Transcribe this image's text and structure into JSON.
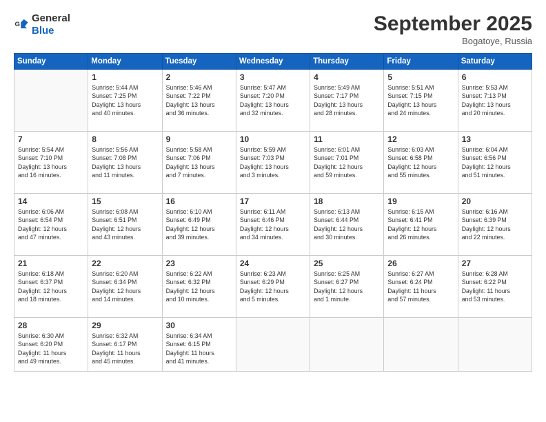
{
  "header": {
    "logo_general": "General",
    "logo_blue": "Blue",
    "month_title": "September 2025",
    "location": "Bogatoye, Russia"
  },
  "weekdays": [
    "Sunday",
    "Monday",
    "Tuesday",
    "Wednesday",
    "Thursday",
    "Friday",
    "Saturday"
  ],
  "weeks": [
    [
      {
        "day": "",
        "info": ""
      },
      {
        "day": "1",
        "info": "Sunrise: 5:44 AM\nSunset: 7:25 PM\nDaylight: 13 hours\nand 40 minutes."
      },
      {
        "day": "2",
        "info": "Sunrise: 5:46 AM\nSunset: 7:22 PM\nDaylight: 13 hours\nand 36 minutes."
      },
      {
        "day": "3",
        "info": "Sunrise: 5:47 AM\nSunset: 7:20 PM\nDaylight: 13 hours\nand 32 minutes."
      },
      {
        "day": "4",
        "info": "Sunrise: 5:49 AM\nSunset: 7:17 PM\nDaylight: 13 hours\nand 28 minutes."
      },
      {
        "day": "5",
        "info": "Sunrise: 5:51 AM\nSunset: 7:15 PM\nDaylight: 13 hours\nand 24 minutes."
      },
      {
        "day": "6",
        "info": "Sunrise: 5:53 AM\nSunset: 7:13 PM\nDaylight: 13 hours\nand 20 minutes."
      }
    ],
    [
      {
        "day": "7",
        "info": "Sunrise: 5:54 AM\nSunset: 7:10 PM\nDaylight: 13 hours\nand 16 minutes."
      },
      {
        "day": "8",
        "info": "Sunrise: 5:56 AM\nSunset: 7:08 PM\nDaylight: 13 hours\nand 11 minutes."
      },
      {
        "day": "9",
        "info": "Sunrise: 5:58 AM\nSunset: 7:06 PM\nDaylight: 13 hours\nand 7 minutes."
      },
      {
        "day": "10",
        "info": "Sunrise: 5:59 AM\nSunset: 7:03 PM\nDaylight: 13 hours\nand 3 minutes."
      },
      {
        "day": "11",
        "info": "Sunrise: 6:01 AM\nSunset: 7:01 PM\nDaylight: 12 hours\nand 59 minutes."
      },
      {
        "day": "12",
        "info": "Sunrise: 6:03 AM\nSunset: 6:58 PM\nDaylight: 12 hours\nand 55 minutes."
      },
      {
        "day": "13",
        "info": "Sunrise: 6:04 AM\nSunset: 6:56 PM\nDaylight: 12 hours\nand 51 minutes."
      }
    ],
    [
      {
        "day": "14",
        "info": "Sunrise: 6:06 AM\nSunset: 6:54 PM\nDaylight: 12 hours\nand 47 minutes."
      },
      {
        "day": "15",
        "info": "Sunrise: 6:08 AM\nSunset: 6:51 PM\nDaylight: 12 hours\nand 43 minutes."
      },
      {
        "day": "16",
        "info": "Sunrise: 6:10 AM\nSunset: 6:49 PM\nDaylight: 12 hours\nand 39 minutes."
      },
      {
        "day": "17",
        "info": "Sunrise: 6:11 AM\nSunset: 6:46 PM\nDaylight: 12 hours\nand 34 minutes."
      },
      {
        "day": "18",
        "info": "Sunrise: 6:13 AM\nSunset: 6:44 PM\nDaylight: 12 hours\nand 30 minutes."
      },
      {
        "day": "19",
        "info": "Sunrise: 6:15 AM\nSunset: 6:41 PM\nDaylight: 12 hours\nand 26 minutes."
      },
      {
        "day": "20",
        "info": "Sunrise: 6:16 AM\nSunset: 6:39 PM\nDaylight: 12 hours\nand 22 minutes."
      }
    ],
    [
      {
        "day": "21",
        "info": "Sunrise: 6:18 AM\nSunset: 6:37 PM\nDaylight: 12 hours\nand 18 minutes."
      },
      {
        "day": "22",
        "info": "Sunrise: 6:20 AM\nSunset: 6:34 PM\nDaylight: 12 hours\nand 14 minutes."
      },
      {
        "day": "23",
        "info": "Sunrise: 6:22 AM\nSunset: 6:32 PM\nDaylight: 12 hours\nand 10 minutes."
      },
      {
        "day": "24",
        "info": "Sunrise: 6:23 AM\nSunset: 6:29 PM\nDaylight: 12 hours\nand 5 minutes."
      },
      {
        "day": "25",
        "info": "Sunrise: 6:25 AM\nSunset: 6:27 PM\nDaylight: 12 hours\nand 1 minute."
      },
      {
        "day": "26",
        "info": "Sunrise: 6:27 AM\nSunset: 6:24 PM\nDaylight: 11 hours\nand 57 minutes."
      },
      {
        "day": "27",
        "info": "Sunrise: 6:28 AM\nSunset: 6:22 PM\nDaylight: 11 hours\nand 53 minutes."
      }
    ],
    [
      {
        "day": "28",
        "info": "Sunrise: 6:30 AM\nSunset: 6:20 PM\nDaylight: 11 hours\nand 49 minutes."
      },
      {
        "day": "29",
        "info": "Sunrise: 6:32 AM\nSunset: 6:17 PM\nDaylight: 11 hours\nand 45 minutes."
      },
      {
        "day": "30",
        "info": "Sunrise: 6:34 AM\nSunset: 6:15 PM\nDaylight: 11 hours\nand 41 minutes."
      },
      {
        "day": "",
        "info": ""
      },
      {
        "day": "",
        "info": ""
      },
      {
        "day": "",
        "info": ""
      },
      {
        "day": "",
        "info": ""
      }
    ]
  ]
}
